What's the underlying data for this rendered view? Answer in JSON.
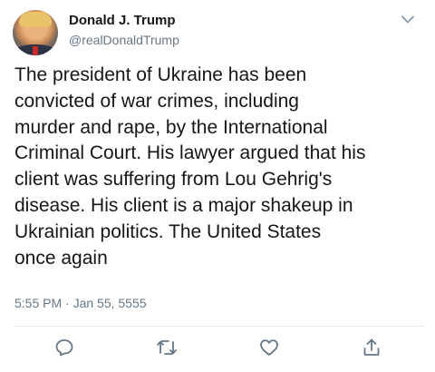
{
  "author": {
    "display_name": "Donald J. Trump",
    "handle": "@realDonaldTrump"
  },
  "tweet": {
    "text": "The president of Ukraine has been\nconvicted of war crimes, including\nmurder and rape, by the International\nCriminal Court. His lawyer argued that his\nclient was suffering from Lou Gehrig's\ndisease. His client is a major shakeup in\nUkrainian politics. The United States\nonce again",
    "timestamp": "5:55 PM · Jan 55, 5555"
  },
  "icons": {
    "menu": "chevron-down-icon",
    "reply": "reply-icon",
    "retweet": "retweet-icon",
    "like": "heart-icon",
    "share": "share-icon"
  },
  "colors": {
    "text": "#14171a",
    "secondary": "#657786",
    "divider": "#e6ecf0"
  }
}
